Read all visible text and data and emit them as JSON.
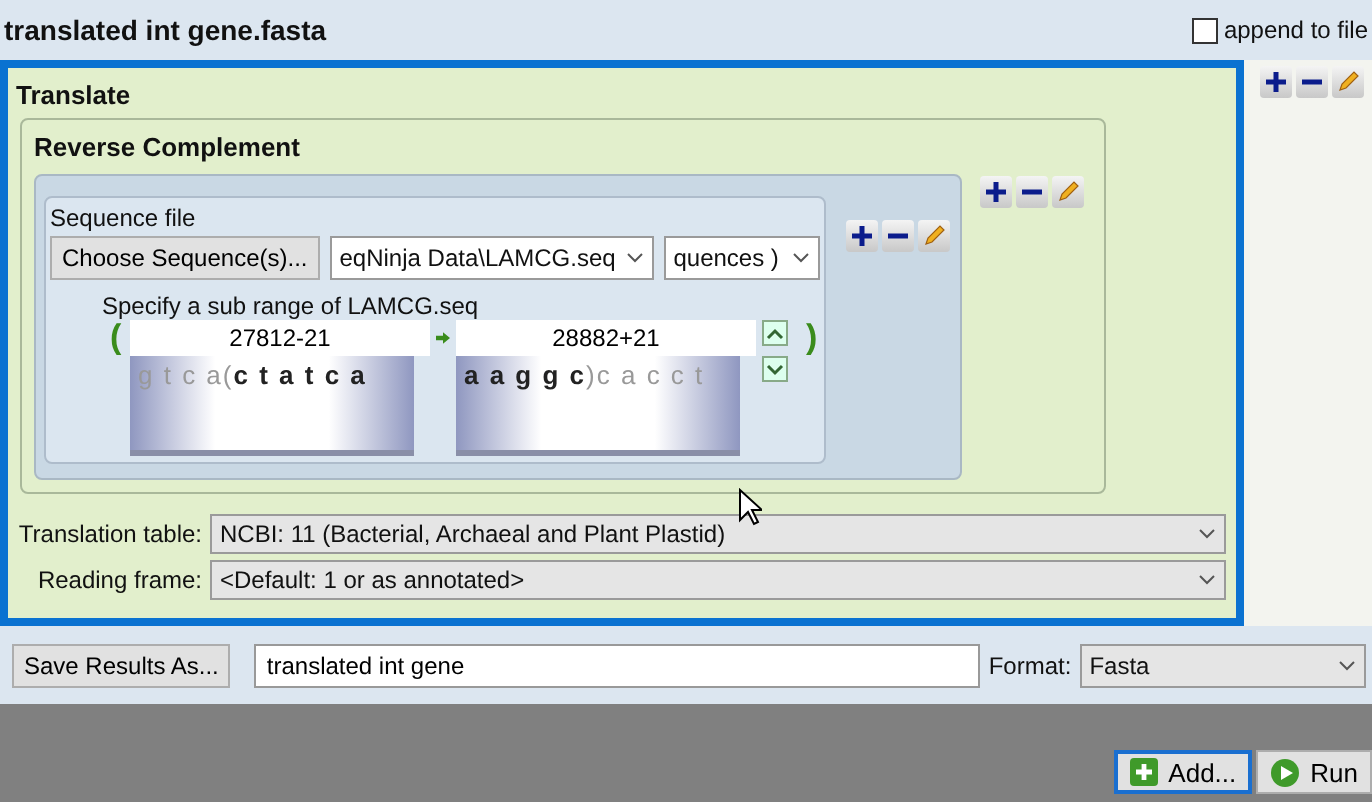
{
  "title": "translated int gene.fasta",
  "append_to_file": {
    "label": "append to file",
    "checked": false
  },
  "translate": {
    "title": "Translate",
    "reverse_complement": {
      "title": "Reverse Complement",
      "sequence_file": {
        "label": "Sequence file",
        "choose_button": "Choose Sequence(s)...",
        "file": "eqNinja Data\\LAMCG.seq",
        "selection": "quences )",
        "range_label": "Specify a sub range of LAMCG.seq",
        "open_bracket": "(",
        "close_bracket": ")",
        "start": "27812-21",
        "end": "28882+21",
        "start_preview": "g t c a(**c t a t c a**",
        "end_preview": "**a a g g c**)c a c c t"
      }
    },
    "settings": [
      {
        "label": "Translation table:",
        "value": "NCBI: 11 (Bacterial, Archaeal and Plant Plastid)"
      },
      {
        "label": "Reading frame:",
        "value": "<Default: 1 or as annotated>"
      }
    ]
  },
  "save": {
    "button": "Save Results As...",
    "filename": "translated int gene",
    "format_label": "Format:",
    "format": "Fasta"
  },
  "buttons": [
    {
      "label": "Add...",
      "kind": "add",
      "focused": true
    },
    {
      "label": "Run",
      "kind": "run",
      "focused": false
    }
  ]
}
